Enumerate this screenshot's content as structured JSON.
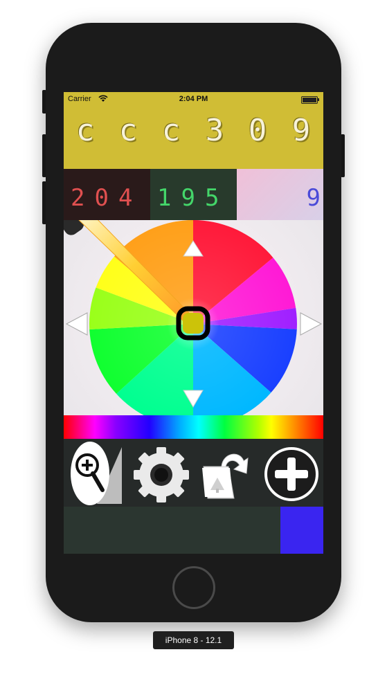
{
  "device": {
    "label": "iPhone 8 - 12.1"
  },
  "status": {
    "carrier": "Carrier",
    "time": "2:04 PM"
  },
  "hex": {
    "chars": [
      "c",
      "c",
      "c",
      "3",
      "0",
      "9"
    ],
    "background": "#d0bd35"
  },
  "rgb": {
    "red": {
      "value": "204",
      "color": "#e05050"
    },
    "green": {
      "value": "195",
      "color": "#44d66a"
    },
    "blue": {
      "value": "9",
      "color": "#4a4ad8"
    }
  },
  "wheel": {
    "up_icon": "triangle-up-icon",
    "down_icon": "triangle-down-icon",
    "left_icon": "triangle-left-icon",
    "right_icon": "triangle-right-icon",
    "picker_icon": "eyedropper-icon",
    "selector_icon": "selection-ring-icon"
  },
  "toolbar": {
    "zoom_icon": "zoom-in-icon",
    "settings_icon": "gear-icon",
    "share_icon": "photo-share-icon",
    "add_icon": "plus-circle-icon"
  },
  "swatch": {
    "color": "#3a25f0"
  }
}
